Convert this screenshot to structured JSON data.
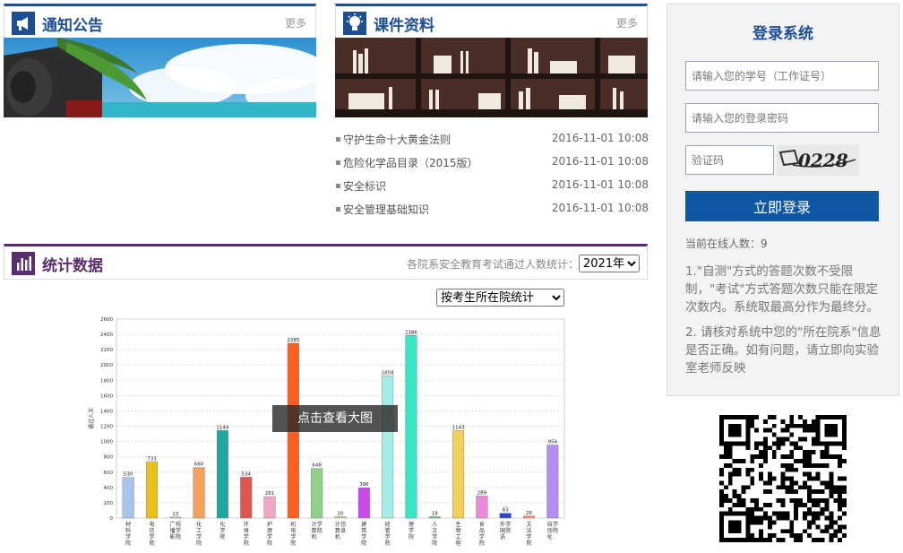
{
  "notice": {
    "title": "通知公告",
    "more": "更多"
  },
  "courseware": {
    "title": "课件资料",
    "more": "更多",
    "items": [
      {
        "title": "守护生命十大黄金法则",
        "date": "2016-11-01 10:08"
      },
      {
        "title": "危险化学品目录（2015版）",
        "date": "2016-11-01 10:08"
      },
      {
        "title": "安全标识",
        "date": "2016-11-01 10:08"
      },
      {
        "title": "安全管理基础知识",
        "date": "2016-11-01 10:08"
      }
    ]
  },
  "login": {
    "title": "登录系统",
    "id_placeholder": "请输入您的学号（工作证号）",
    "pwd_placeholder": "请输入您的登录密码",
    "code_placeholder": "验证码",
    "captcha_text": "0228",
    "button": "立即登录",
    "online": "当前在线人数：9",
    "note1": "1.\"自测\"方式的答题次数不受限制，\"考试\"方式答题次数只能在限定次数内。系统取最高分作为最终分。",
    "note2": "2. 请核对系统中您的\"所在院系\"信息是否正确。如有问题，请立即向实验室老师反映"
  },
  "stats": {
    "title": "统计数据",
    "caption": "各院系安全教育考试通过人数统计：",
    "year": "2021年",
    "group_by": "按考生所在院统计",
    "overlay": "点击查看大图"
  },
  "colors": {
    "brand": "#1d4f96",
    "stats": "#5a2d6e",
    "button": "#0f57a3"
  },
  "chart_data": {
    "type": "bar",
    "ylabel": "通过人次",
    "ylim": [
      0,
      2600
    ],
    "yticks": [
      0,
      200,
      400,
      600,
      800,
      1000,
      1200,
      1400,
      1600,
      1800,
      2000,
      2200,
      2400,
      2600
    ],
    "categories": [
      "材料学院",
      "电信学院",
      "广播影视学院",
      "化工学院",
      "化学院",
      "环境学院",
      "护理学院",
      "机电学院",
      "计算机学院",
      "计算机信息",
      "建筑学院",
      "经管学院",
      "理学院",
      "人文学院",
      "生物工程",
      "食品学院",
      "外国语学院",
      "文法学院",
      "自动化学院"
    ],
    "values": [
      530,
      733,
      13,
      660,
      1144,
      534,
      281,
      2285,
      648,
      20,
      396,
      1858,
      2386,
      18,
      1143,
      289,
      63,
      26,
      954
    ],
    "colors": [
      "#a9c4ea",
      "#e8c21a",
      "#bdbdbd",
      "#f2a25c",
      "#1fa7a0",
      "#e0574f",
      "#f1a6c8",
      "#ff5e1e",
      "#8fd08a",
      "#ddd2a0",
      "#c64be8",
      "#a5ece6",
      "#37e6c4",
      "#60c46a",
      "#f3d05c",
      "#ea8bd9",
      "#2c43d6",
      "#f08c7c",
      "#b58df0"
    ]
  }
}
